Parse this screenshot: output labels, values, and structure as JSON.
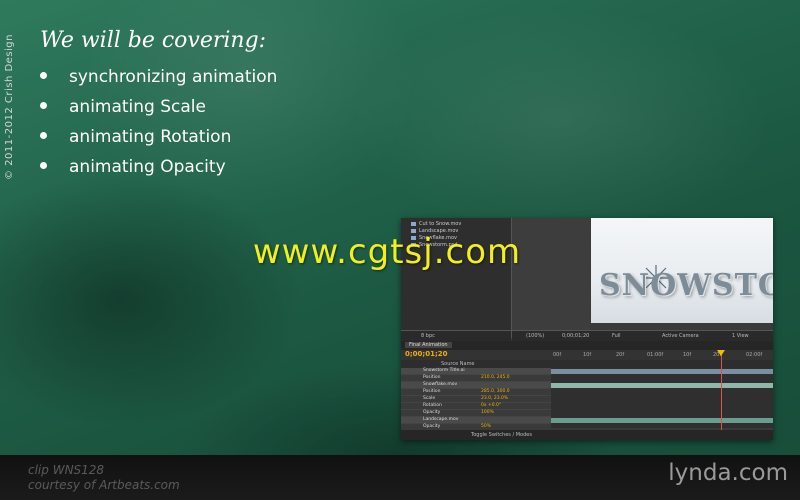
{
  "slide": {
    "copyright": "© 2011-2012 Crish Design",
    "heading": "We will be covering:",
    "bullets": [
      "synchronizing animation",
      "animating Scale",
      "animating Rotation",
      "animating Opacity"
    ]
  },
  "screenshot": {
    "project_items": [
      "Cut to Snow.mov",
      "Landscape.mov",
      "Snowflake.mov",
      "Snowstorm.psd"
    ],
    "viewer_title": "SNOWSTORM",
    "viewer_bar": [
      "(100%)",
      "0;00;01;20",
      "Full",
      "Active Camera",
      "1 View"
    ],
    "project_bar": "8 bpc",
    "timeline_tab": "Final Animation",
    "timecode": "0;00;01;20",
    "ruler_ticks": [
      "00f",
      "10f",
      "20f",
      "01:00f",
      "10f",
      "20f",
      "02:00f"
    ],
    "column_header": "Source Name",
    "layers": [
      {
        "name": "Snowstorm Title.ai",
        "value": ""
      },
      {
        "name": "Position",
        "value": "210.0, 245.0"
      },
      {
        "name": "Snowflake.mov",
        "value": ""
      },
      {
        "name": "Position",
        "value": "285.0, 300.0"
      },
      {
        "name": "Scale",
        "value": "23.0, 23.0%"
      },
      {
        "name": "Rotation",
        "value": "0x +0.0°"
      },
      {
        "name": "Opacity",
        "value": "100%"
      },
      {
        "name": "Landscape.mov",
        "value": ""
      },
      {
        "name": "Opacity",
        "value": "50%"
      }
    ],
    "toggle_label": "Toggle Switches / Modes"
  },
  "watermark": "www.cgtsj.com",
  "footer": {
    "clip_id": "clip WNS128",
    "credit": "courtesy of Artbeats.com",
    "logo": "lynda.com"
  },
  "colors": {
    "background": "#21634b",
    "watermark": "#f2ef1f",
    "timecode": "#f0b000"
  }
}
